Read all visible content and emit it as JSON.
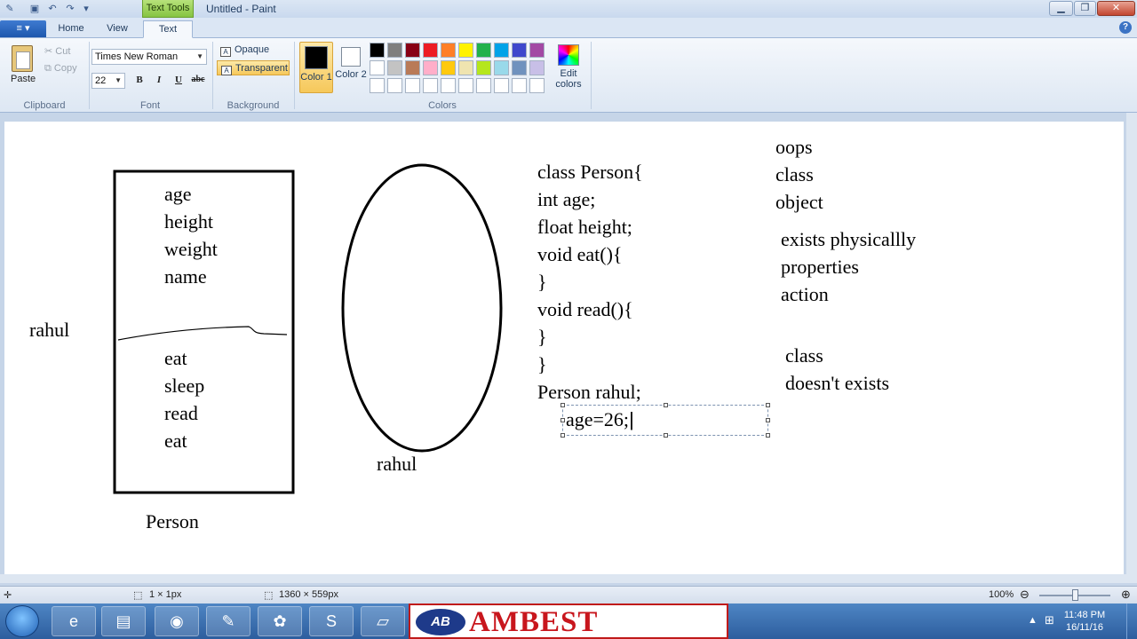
{
  "window": {
    "title": "Untitled - Paint",
    "context_tab": "Text Tools"
  },
  "ribbon": {
    "file_menu": "≡ ▾",
    "tabs": [
      "Home",
      "View",
      "Text"
    ],
    "active_tab": "Text",
    "clipboard": {
      "paste": "Paste",
      "cut": "Cut",
      "copy": "Copy",
      "group": "Clipboard"
    },
    "font": {
      "family": "Times New Roman",
      "size": "22",
      "bold": "B",
      "italic": "I",
      "underline": "U",
      "strike": "abc",
      "group": "Font"
    },
    "background": {
      "opaque": "Opaque",
      "transparent": "Transparent",
      "group": "Background"
    },
    "colors": {
      "color1_label": "Color 1",
      "color2_label": "Color 2",
      "color1": "#000000",
      "color2": "#ffffff",
      "edit_label": "Edit colors",
      "group": "Colors",
      "palette": [
        "#000000",
        "#7f7f7f",
        "#880015",
        "#ed1c24",
        "#ff7f27",
        "#fff200",
        "#22b14c",
        "#00a2e8",
        "#3f48cc",
        "#a349a4",
        "#ffffff",
        "#c3c3c3",
        "#b97a57",
        "#ffaec9",
        "#ffc90e",
        "#efe4b0",
        "#b5e61d",
        "#99d9ea",
        "#7092be",
        "#c8bfe7",
        "#ffffff",
        "#ffffff",
        "#ffffff",
        "#ffffff",
        "#ffffff",
        "#ffffff",
        "#ffffff",
        "#ffffff",
        "#ffffff",
        "#ffffff"
      ]
    }
  },
  "canvas": {
    "left_label": "rahul",
    "box_attributes": [
      "age",
      "height",
      "weight",
      "name"
    ],
    "box_methods": [
      "eat",
      "sleep",
      "read",
      "eat"
    ],
    "box_caption": "Person",
    "oval_caption": "rahul",
    "code_lines": [
      "class Person{",
      "int age;",
      "float height;",
      "void eat(){",
      "}",
      "void read(){",
      "}",
      "}",
      "Person rahul;"
    ],
    "typing_text": "age=26;",
    "notes_a": [
      "oops",
      "class",
      "object"
    ],
    "notes_b": [
      "exists physicallly",
      "properties",
      "action"
    ],
    "notes_c": [
      "class",
      "doesn't exists"
    ]
  },
  "status": {
    "selection": "1 × 1px",
    "size": "1360 × 559px",
    "zoom": "100%"
  },
  "taskbar": {
    "banner_logo": "AB",
    "banner": "AMBEST",
    "time": "11:48 PM",
    "date": "16/11/16"
  }
}
